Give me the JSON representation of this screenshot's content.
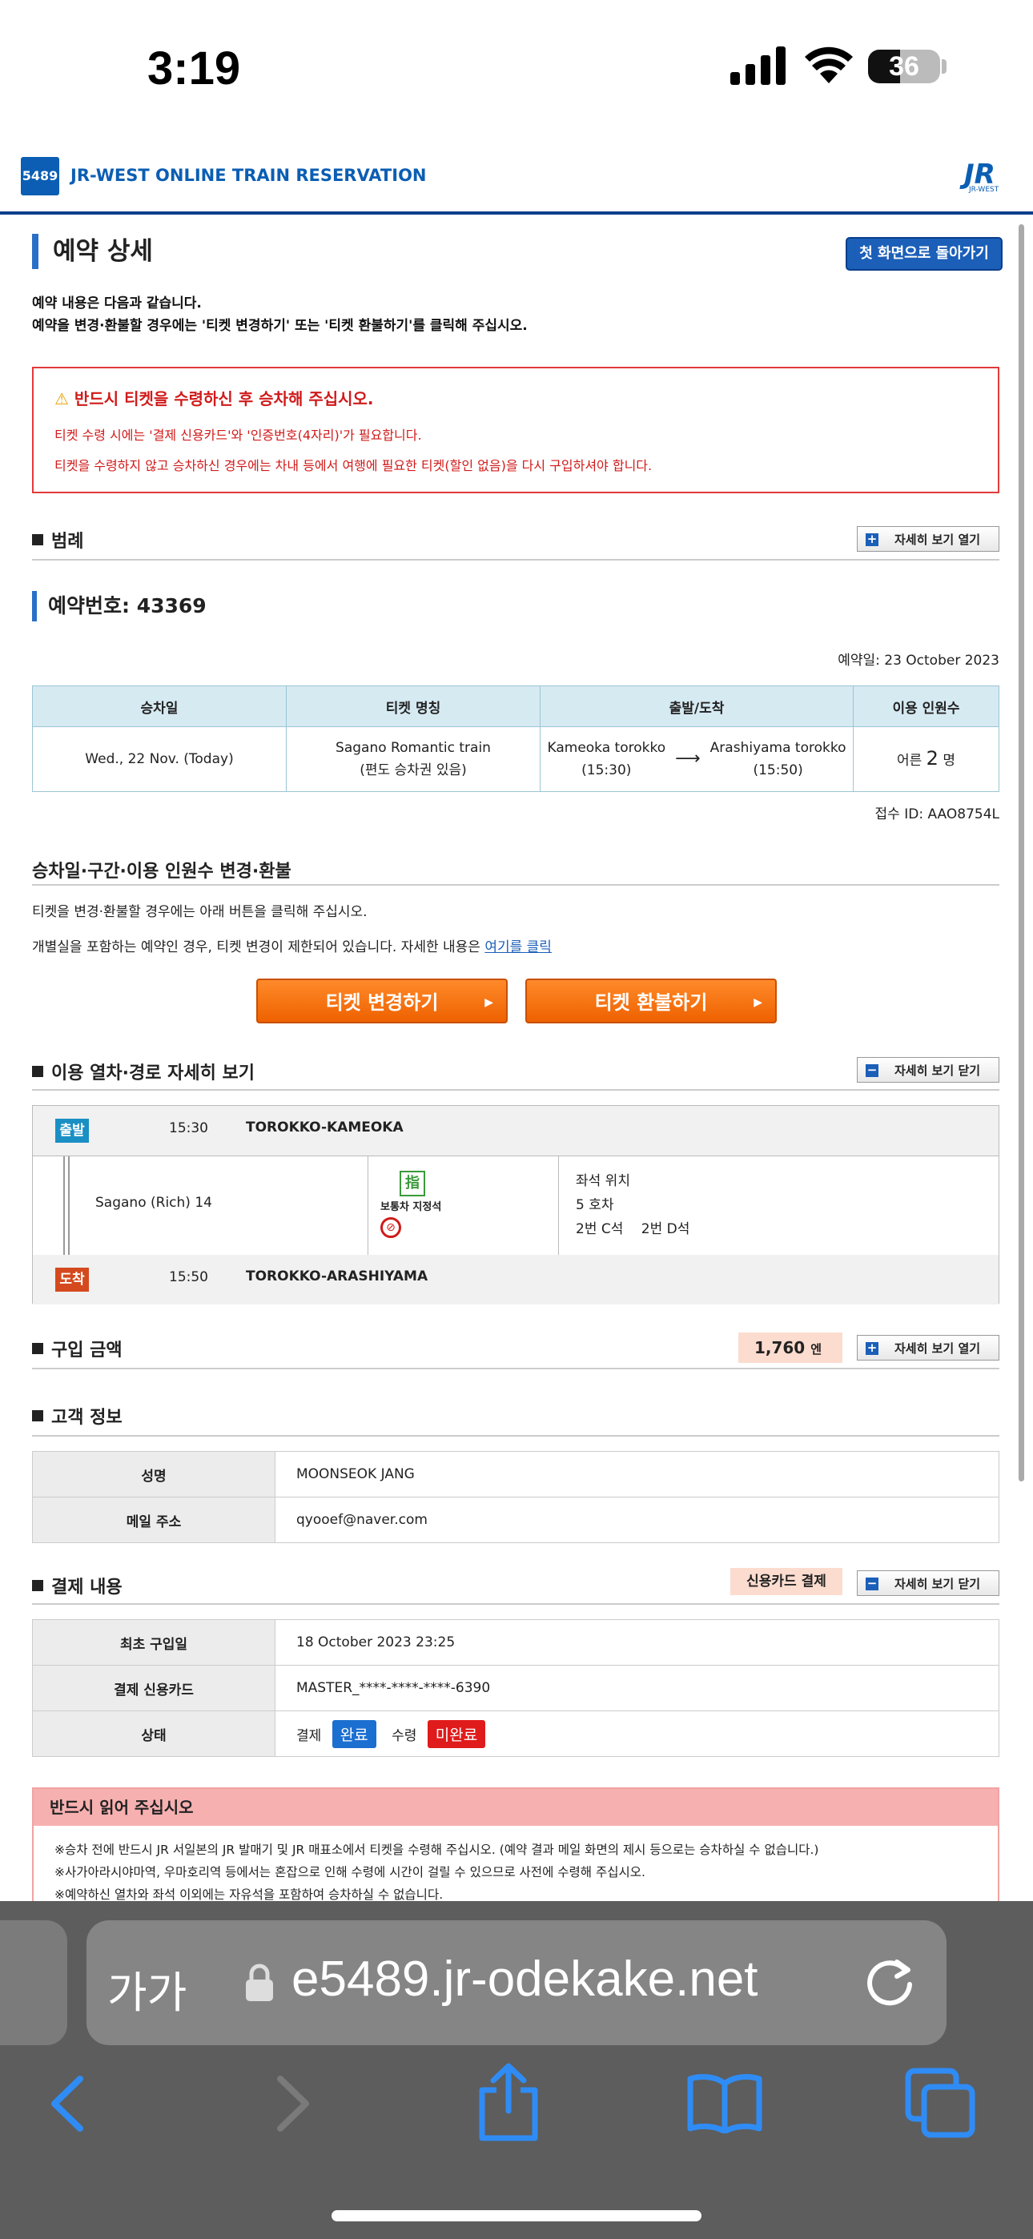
{
  "status_bar": {
    "time": "3:19",
    "battery": "36"
  },
  "header": {
    "logo_text": "5489",
    "brand": "JR-WEST ONLINE TRAIN RESERVATION",
    "jr_logo": "JR",
    "jr_sub": "JR-WEST"
  },
  "page": {
    "title": "예약 상세",
    "back_button": "첫 화면으로 돌아가기",
    "intro_1": "예약 내용은 다음과 같습니다.",
    "intro_2": "예약을 변경·환불할 경우에는 '티켓 변경하기' 또는 '티켓 환불하기'를 클릭해 주십시오."
  },
  "warning": {
    "title": "반드시 티켓을 수령하신 후 승차해 주십시오.",
    "line_1": "티켓 수령 시에는 '결제 신용카드'와 '인증번호(4자리)'가 필요합니다.",
    "line_2": "티켓을 수령하지 않고 승차하신 경우에는 차내 등에서 여행에 필요한 티켓(할인 없음)을 다시 구입하셔야 합니다."
  },
  "legend": {
    "title": "범례",
    "toggle": "자세히 보기 열기"
  },
  "reservation": {
    "title": "예약번호: 43369",
    "date": "예약일: 23 October 2023",
    "headers": [
      "승차일",
      "티켓 명칭",
      "출발/도착",
      "이용 인원수"
    ],
    "ride_date": "Wed., 22 Nov. (Today)",
    "ticket_name_1": "Sagano Romantic train",
    "ticket_name_2": "(편도 승차권 있음)",
    "from_station": "Kameoka torokko",
    "from_time": "(15:30)",
    "to_station": "Arashiyama torokko",
    "to_time": "(15:50)",
    "people_prefix": "어른",
    "people_count": "2",
    "people_suffix": "명",
    "receipt_id": "접수 ID: AAO8754L"
  },
  "change": {
    "title": "승차일·구간·이용 인원수 변경·환불",
    "line_1": "티켓을 변경·환불할 경우에는 아래 버튼을 클릭해 주십시오.",
    "line_2": "개별실을 포함하는 예약인 경우, 티켓 변경이 제한되어 있습니다. 자세한 내용은",
    "link": "여기를 클릭",
    "btn_change": "티켓 변경하기",
    "btn_refund": "티켓 환불하기"
  },
  "route": {
    "title": "이용 열차·경로 자세히 보기",
    "toggle": "자세히 보기 닫기",
    "depart_tag": "출발",
    "depart_time": "15:30",
    "depart_station": "TOROKKO-KAMEOKA",
    "train": "Sagano (Rich) 14",
    "seat_icon": "指",
    "seat_type": "보통차 지정석",
    "seat_pos_label": "좌석 위치",
    "car": "5 호차",
    "seats": "2번 C석　 2번 D석",
    "arrive_tag": "도착",
    "arrive_time": "15:50",
    "arrive_station": "TOROKKO-ARASHIYAMA"
  },
  "price": {
    "title": "구입 금액",
    "amount": "1,760",
    "unit": "엔",
    "toggle": "자세히 보기 열기"
  },
  "customer": {
    "title": "고객 정보",
    "rows": [
      {
        "label": "성명",
        "value": "MOONSEOK JANG"
      },
      {
        "label": "메일 주소",
        "value": "qyooef@naver.com"
      }
    ]
  },
  "payment": {
    "title": "결제 내용",
    "method": "신용카드 결제",
    "toggle": "자세히 보기 닫기",
    "first_label": "최초 구입일",
    "first_value": "18 October 2023 23:25",
    "card_label": "결제 신용카드",
    "card_value": "MASTER_****-****-****-6390",
    "status_label": "상태",
    "pay_label": "결제",
    "pay_status": "완료",
    "receive_label": "수령",
    "receive_status": "미완료"
  },
  "notice": {
    "title": "반드시 읽어 주십시오",
    "line_1": "※승차 전에 반드시 JR 서일본의 JR 발매기 및 JR 매표소에서 티켓을 수령해 주십시오. (예약 결과 메일 화면의 제시 등으로는 승차하실 수 없습니다.)",
    "line_2": "※사가아라시야마역, 우마호리역 등에서는 혼잡으로 인해 수령에 시간이 걸릴 수 있으므로 사전에 수령해 주십시오.",
    "line_3": "※예약하신 열차와 좌석 이외에는 자유석을 포함하여 승차하실 수 없습니다."
  },
  "browser": {
    "aa": "가가",
    "url": "e5489.jr-odekake.net"
  },
  "colors": {
    "brand_blue": "#0b5eb3",
    "orange": "#ee6100",
    "warn_red": "#d01a1a",
    "depart": "#1a8fc4",
    "arrive": "#d44a1e"
  }
}
